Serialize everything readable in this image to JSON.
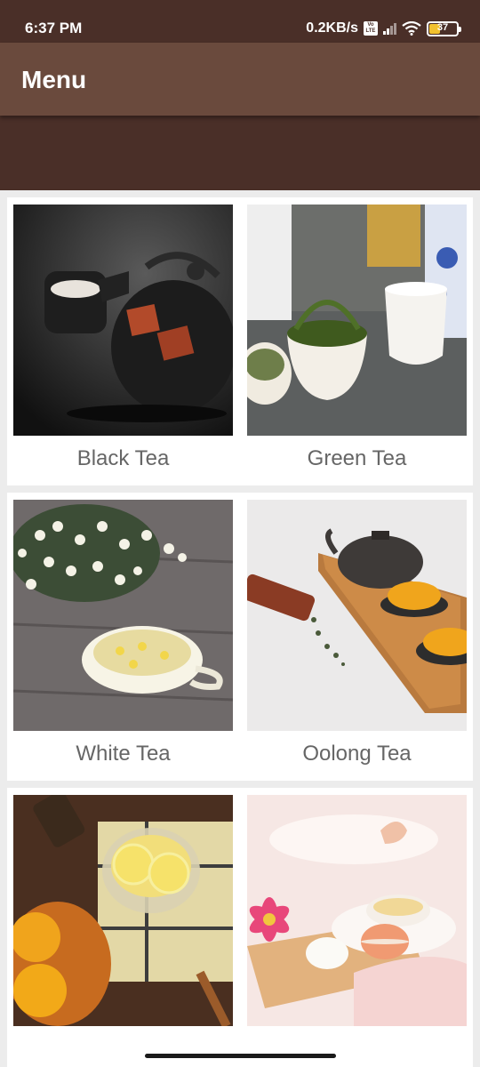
{
  "status_bar": {
    "time": "6:37 PM",
    "network_speed": "0.2KB/s",
    "volte_label": "Vo LTE",
    "battery_level": "37",
    "icons": [
      "volte-icon",
      "signal-icon",
      "wifi-icon",
      "battery-icon"
    ]
  },
  "app_bar": {
    "title": "Menu"
  },
  "menu": {
    "items": [
      {
        "label": "Black Tea"
      },
      {
        "label": "Green Tea"
      },
      {
        "label": "White Tea"
      },
      {
        "label": "Oolong Tea"
      },
      {
        "label": ""
      },
      {
        "label": ""
      }
    ]
  },
  "colors": {
    "status_bar": "#4a2f28",
    "app_bar": "#6a4a3d",
    "label_text": "#666666",
    "background": "#ececec"
  }
}
